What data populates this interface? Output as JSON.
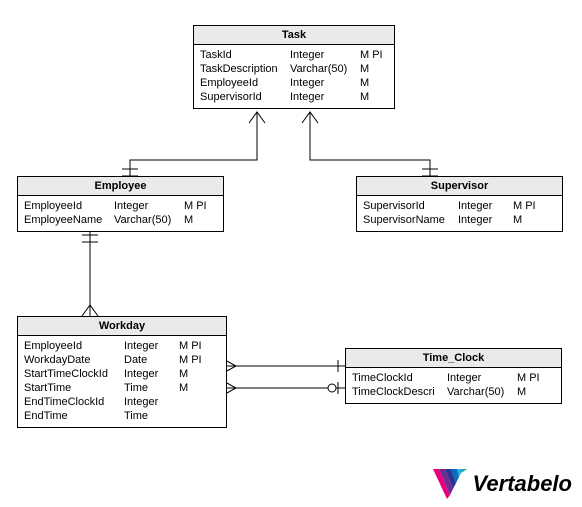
{
  "entities": {
    "task": {
      "title": "Task",
      "rows": [
        {
          "name": "TaskId",
          "type": "Integer",
          "flags": "M PI"
        },
        {
          "name": "TaskDescription",
          "type": "Varchar(50)",
          "flags": "M"
        },
        {
          "name": "EmployeeId",
          "type": "Integer",
          "flags": "M"
        },
        {
          "name": "SupervisorId",
          "type": "Integer",
          "flags": "M"
        }
      ]
    },
    "employee": {
      "title": "Employee",
      "rows": [
        {
          "name": "EmployeeId",
          "type": "Integer",
          "flags": "M PI"
        },
        {
          "name": "EmployeeName",
          "type": "Varchar(50)",
          "flags": "M"
        }
      ]
    },
    "supervisor": {
      "title": "Supervisor",
      "rows": [
        {
          "name": "SupervisorId",
          "type": "Integer",
          "flags": "M PI"
        },
        {
          "name": "SupervisorName",
          "type": "Integer",
          "flags": "M"
        }
      ]
    },
    "workday": {
      "title": "Workday",
      "rows": [
        {
          "name": "EmployeeId",
          "type": "Integer",
          "flags": "M PI"
        },
        {
          "name": "WorkdayDate",
          "type": "Date",
          "flags": "M PI"
        },
        {
          "name": "StartTimeClockId",
          "type": "Integer",
          "flags": "M"
        },
        {
          "name": "StartTime",
          "type": "Time",
          "flags": "M"
        },
        {
          "name": "EndTimeClockId",
          "type": "Integer",
          "flags": ""
        },
        {
          "name": "EndTime",
          "type": "Time",
          "flags": ""
        }
      ]
    },
    "timeclock": {
      "title": "Time_Clock",
      "rows": [
        {
          "name": "TimeClockId",
          "type": "Integer",
          "flags": "M PI"
        },
        {
          "name": "TimeClockDescri",
          "type": "Varchar(50)",
          "flags": "M"
        }
      ]
    }
  },
  "logo": "Vertabelo"
}
